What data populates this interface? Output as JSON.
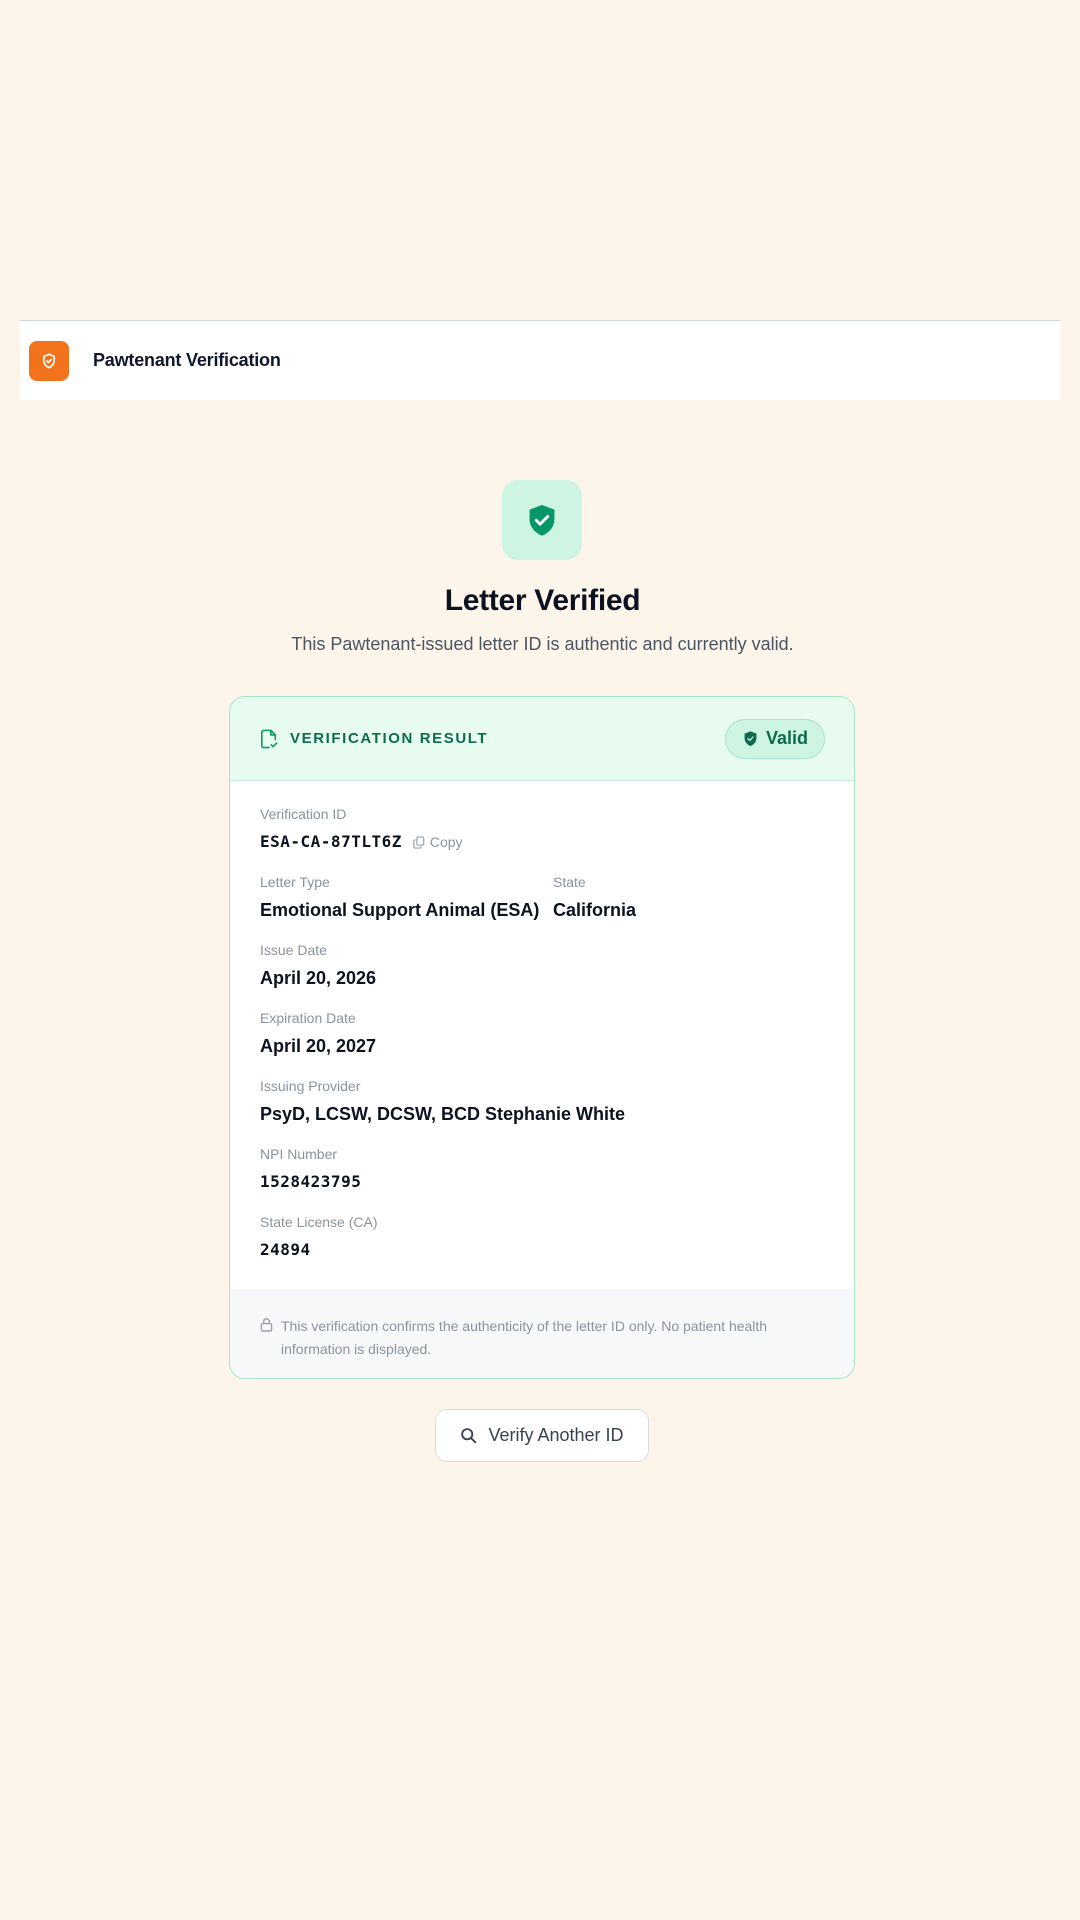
{
  "header": {
    "title": "Pawtenant Verification",
    "logo_icon": "shield-check-icon",
    "brand_color": "#f2731c"
  },
  "hero": {
    "icon": "shield-check-icon",
    "title": "Letter Verified",
    "subtitle": "This Pawtenant-issued letter ID is authentic and currently valid."
  },
  "card": {
    "header_icon": "document-check-icon",
    "header_title": "VERIFICATION RESULT",
    "status_badge": "Valid",
    "status_color": "#0c6b4f",
    "fields": {
      "verification_id": {
        "label": "Verification ID",
        "value": "ESA-CA-87TLT6Z",
        "copy_label": "Copy"
      },
      "letter_type": {
        "label": "Letter Type",
        "value": "Emotional Support Animal (ESA)"
      },
      "state": {
        "label": "State",
        "value": "California"
      },
      "issue_date": {
        "label": "Issue Date",
        "value": "April 20, 2026"
      },
      "expiration_date": {
        "label": "Expiration Date",
        "value": "April 20, 2027"
      },
      "issuing_provider": {
        "label": "Issuing Provider",
        "value": "PsyD, LCSW, DCSW, BCD Stephanie White"
      },
      "npi_number": {
        "label": "NPI Number",
        "value": "1528423795"
      },
      "state_license": {
        "label": "State License (CA)",
        "value": "24894"
      }
    },
    "footer_note": "This verification confirms the authenticity of the letter ID only. No patient health information is displayed."
  },
  "actions": {
    "verify_another_label": "Verify Another ID"
  }
}
